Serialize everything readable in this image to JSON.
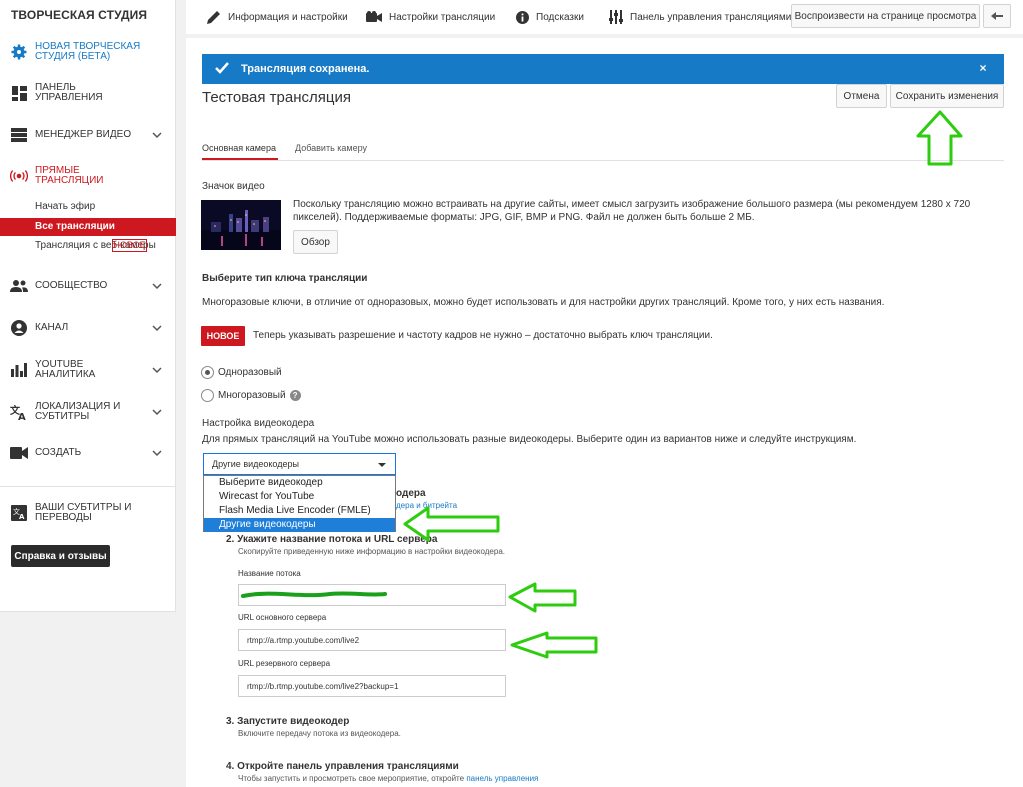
{
  "sidebar": {
    "title": "ТВОРЧЕСКАЯ СТУДИЯ",
    "items": [
      {
        "label": "НОВАЯ ТВОРЧЕСКАЯ СТУДИЯ (БЕТА)",
        "icon": "gear-icon"
      },
      {
        "label": "ПАНЕЛЬ УПРАВЛЕНИЯ",
        "icon": "dashboard-icon"
      },
      {
        "label": "МЕНЕДЖЕР ВИДЕО",
        "icon": "video-manager-icon"
      },
      {
        "label": "ПРЯМЫЕ ТРАНСЛЯЦИИ",
        "icon": "live-broadcast-icon"
      },
      {
        "label": "СООБЩЕСТВО",
        "icon": "community-icon"
      },
      {
        "label": "КАНАЛ",
        "icon": "channel-icon"
      },
      {
        "label": "YOUTUBE АНАЛИТИКА",
        "icon": "analytics-icon"
      },
      {
        "label": "ЛОКАЛИЗАЦИЯ И СУБТИТРЫ",
        "icon": "translate-icon"
      },
      {
        "label": "СОЗДАТЬ",
        "icon": "create-video-icon"
      },
      {
        "label": "ВАШИ СУБТИТРЫ И ПЕРЕВОДЫ",
        "icon": "subtitles-translate-icon"
      }
    ],
    "live_sub": [
      "Начать эфир",
      "Все трансляции",
      "Трансляция с веб-камеры"
    ],
    "live_sub_badge": "НОВОЕ",
    "help_button": "Справка и отзывы",
    "accent_color": "#cc181e",
    "link_color": "#167ac6"
  },
  "topbar": {
    "tabs": [
      {
        "label": "Информация и настройки",
        "icon": "pencil-icon"
      },
      {
        "label": "Настройки трансляции",
        "icon": "camera-icon"
      },
      {
        "label": "Подсказки",
        "icon": "info-icon"
      },
      {
        "label": "Панель управления трансляциями",
        "icon": "sliders-icon"
      }
    ],
    "view_button": "Воспроизвести на странице просмотра",
    "back_icon": "back-arrow-icon"
  },
  "banner": {
    "message": "Трансляция сохранена.",
    "close": "×",
    "color": "#167ac6"
  },
  "page": {
    "title": "Тестовая трансляция",
    "cancel_button": "Отмена",
    "save_button": "Сохранить изменения",
    "tabs": [
      "Основная камера",
      "Добавить камеру"
    ]
  },
  "thumbnail": {
    "heading": "Значок видео",
    "description": "Поскольку трансляцию можно встраивать на другие сайты, имеет смысл загрузить изображение большого размера (мы рекомендуем 1280 x 720 пикселей). Поддерживаемые форматы: JPG, GIF, BMP и PNG. Файл не должен быть больше 2 МБ.",
    "browse_button": "Обзор"
  },
  "key_type": {
    "heading": "Выберите тип ключа трансляции",
    "description": "Многоразовые ключи, в отличие от одноразовых, можно будет использовать и для настройки других трансляций. Кроме того, у них есть названия.",
    "badge": "НОВОЕ",
    "notice": "Теперь указывать разрешение и частоту кадров не нужно – достаточно выбрать ключ трансляции.",
    "options": [
      {
        "label": "Одноразовый",
        "selected": true
      },
      {
        "label": "Многоразовый",
        "selected": false
      }
    ],
    "help_icon": "?"
  },
  "encoder": {
    "heading": "Настройка видеокодера",
    "description": "Для прямых трансляций на YouTube можно использовать разные видеокодеры. Выберите один из вариантов ниже и следуйте инструкциям.",
    "selected": "Другие видеокодеры",
    "options": [
      {
        "label": "Выберите видеокодер",
        "selected": false
      },
      {
        "label": "Wirecast for YouTube",
        "selected": false
      },
      {
        "label": "Flash Media Live Encoder (FMLE)",
        "selected": false
      },
      {
        "label": "Другие видеокодеры",
        "selected": true
      }
    ],
    "behind_step1_title": "одера",
    "behind_step1_link": "дера и битрейта"
  },
  "steps": [
    {
      "title": "2. Укажите название потока и URL сервера",
      "subtitle": "Скопируйте приведенную ниже информацию в настройки видеокодера."
    },
    {
      "title": "3. Запустите видеокодер",
      "subtitle": "Включите передачу потока из видеокодера."
    },
    {
      "title": "4. Откройте панель управления трансляциями",
      "subtitle": "Чтобы запустить и просмотреть свое мероприятие, откройте",
      "link": "панель управления"
    }
  ],
  "stream_fields": {
    "stream_name_label": "Название потока",
    "stream_name_value": "",
    "primary_url_label": "URL основного сервера",
    "primary_url_value": "rtmp://a.rtmp.youtube.com/live2",
    "backup_url_label": "URL резервного сервера",
    "backup_url_value": "rtmp://b.rtmp.youtube.com/live2?backup=1"
  },
  "annotations": {
    "arrow_color": "#2ecc0f",
    "scribble_color": "#1aa01a"
  }
}
